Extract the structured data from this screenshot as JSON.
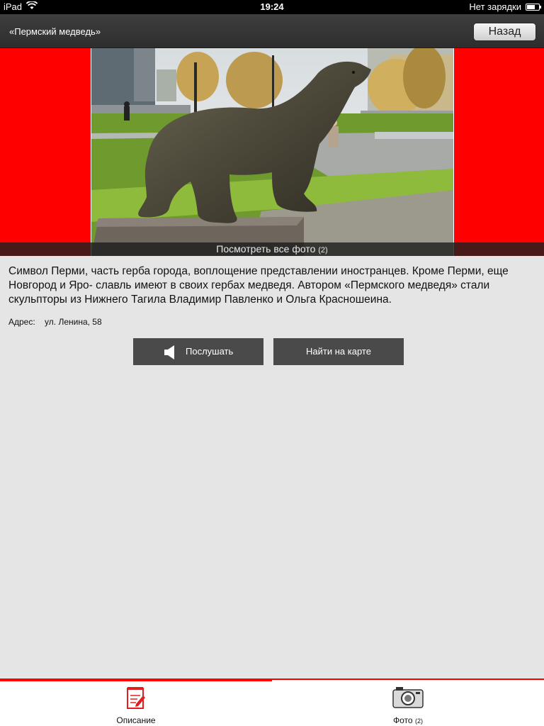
{
  "status_bar": {
    "device": "iPad",
    "time": "19:24",
    "charging": "Нет зарядки"
  },
  "nav": {
    "title": "«Пермский медведь»",
    "back_label": "Назад"
  },
  "hero": {
    "view_all_label": "Посмотреть все фото",
    "photo_count": "(2)"
  },
  "content": {
    "description": "Символ Перми, часть герба города, воплощение представлении иностранцев. Кроме Перми, еще Новгород и Яро- славль имеют в своих гербах медведя. Автором «Пермского медведя» стали скульпторы из Нижнего Тагила Владимир Павленко и Ольга Красношеина.",
    "address_label": "Адрес:",
    "address_value": "ул. Ленина, 58"
  },
  "actions": {
    "listen_label": "Послушать",
    "map_label": "Найти на карте"
  },
  "tabs": [
    {
      "label": "Описание",
      "icon": "notepad-icon",
      "active": true
    },
    {
      "label": "Фото",
      "count": "(2)",
      "icon": "camera-icon",
      "active": false
    }
  ],
  "colors": {
    "accent": "#ff0000",
    "button_bg": "#4a4a4a",
    "page_bg": "#e5e5e5"
  }
}
